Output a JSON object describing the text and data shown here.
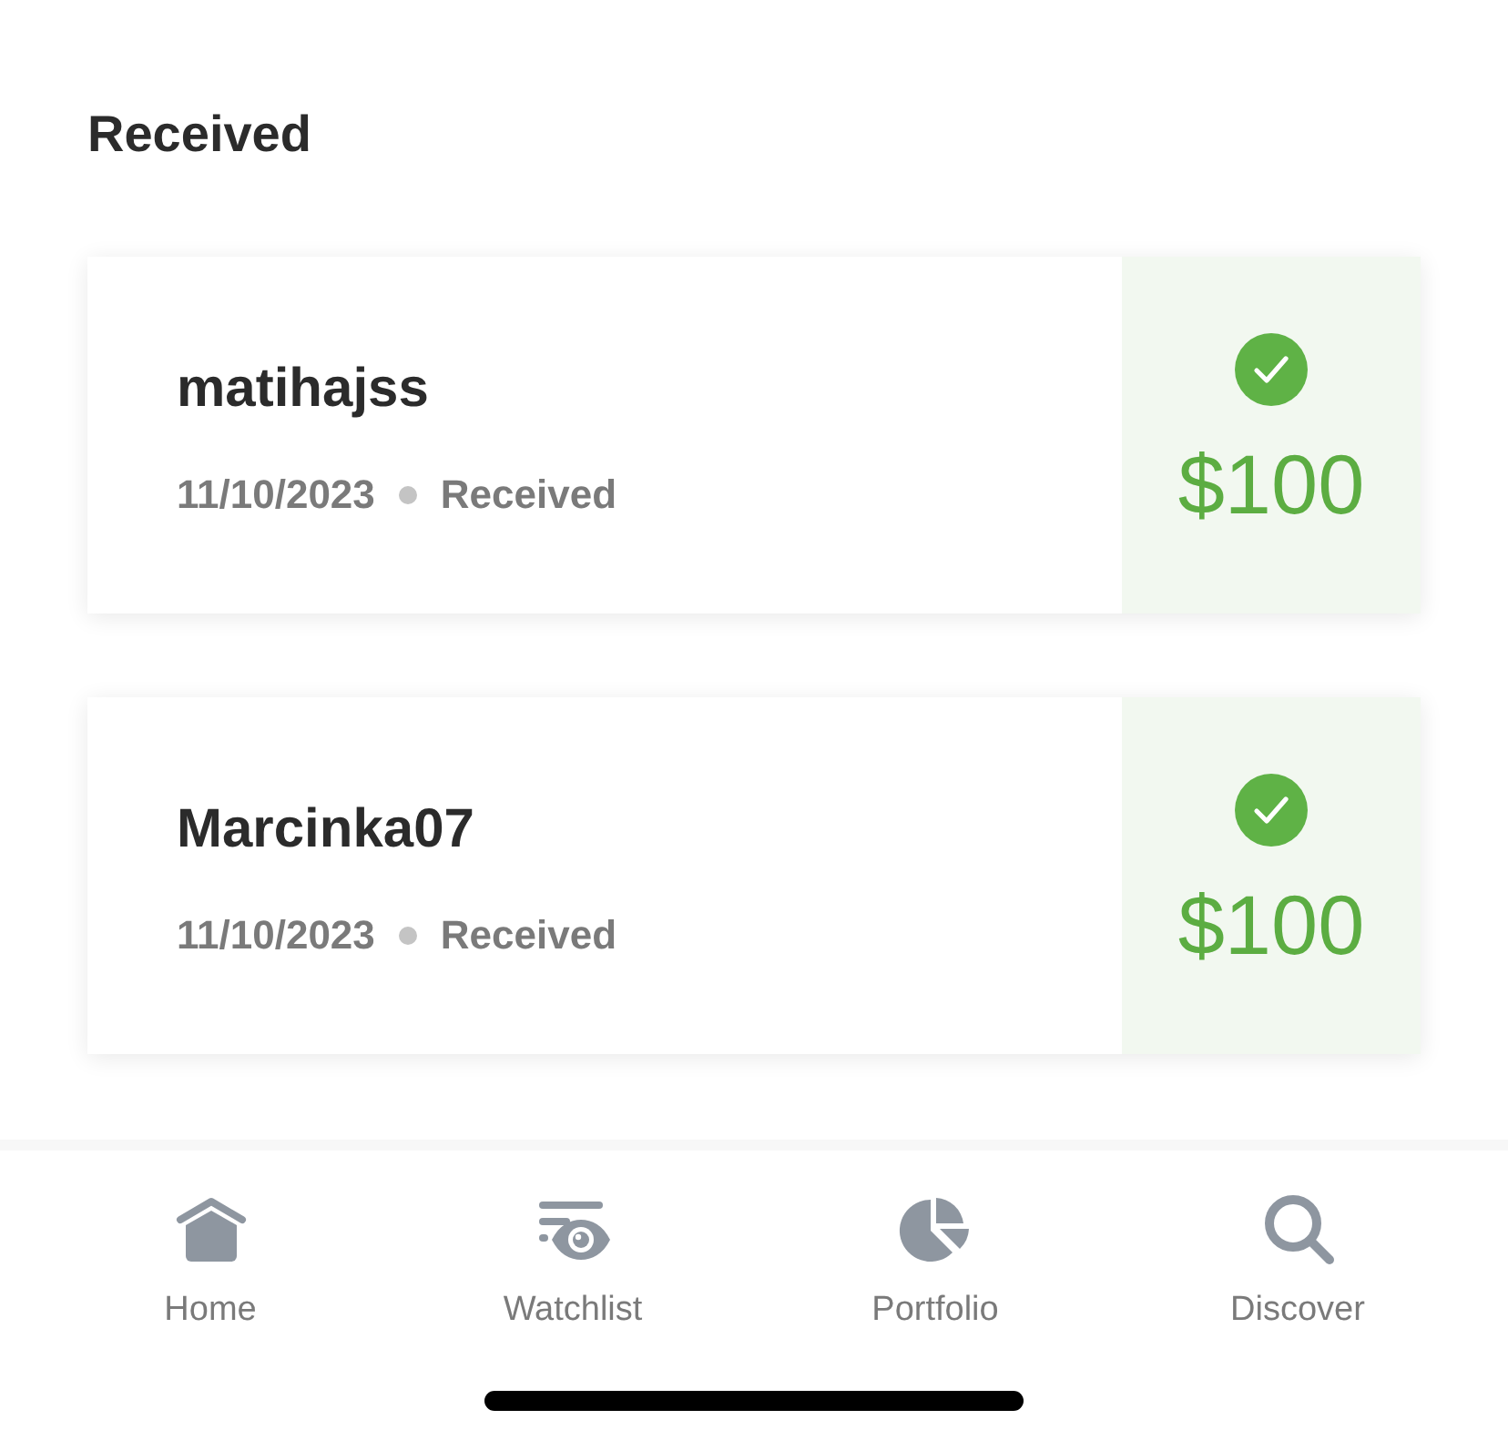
{
  "header": {
    "title": "Received"
  },
  "transactions": [
    {
      "name": "matihajss",
      "date": "11/10/2023",
      "status": "Received",
      "amount": "$100"
    },
    {
      "name": "Marcinka07",
      "date": "11/10/2023",
      "status": "Received",
      "amount": "$100"
    }
  ],
  "tab_bar": {
    "tabs": [
      {
        "kind": "home",
        "label": "Home",
        "selected": false
      },
      {
        "kind": "watchlist",
        "label": "Watchlist",
        "selected": false
      },
      {
        "kind": "portfolio",
        "label": "Portfolio",
        "selected": false
      },
      {
        "kind": "discover",
        "label": "Discover",
        "selected": false
      }
    ]
  }
}
